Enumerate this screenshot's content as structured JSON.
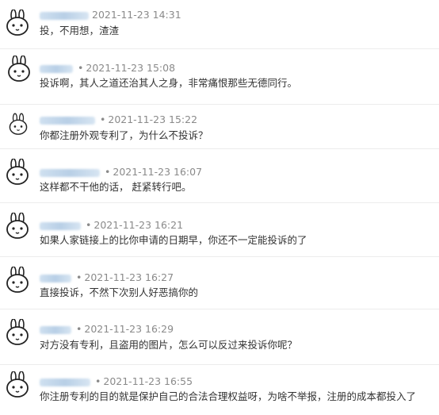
{
  "comments": [
    {
      "timestamp": "2021-11-23 14:31",
      "text": "投，不用想，渣渣"
    },
    {
      "timestamp": "2021-11-23 15:08",
      "text": "投诉啊，其人之道还治其人之身，非常痛恨那些无德同行。"
    },
    {
      "timestamp": "2021-11-23 15:22",
      "text": "你都注册外观专利了，为什么不投诉？"
    },
    {
      "timestamp": "2021-11-23 16:07",
      "text": "这样都不干他的话，  赶紧转行吧。"
    },
    {
      "timestamp": "2021-11-23 16:21",
      "text": "如果人家链接上的比你申请的日期早，你还不一定能投诉的了"
    },
    {
      "timestamp": "2021-11-23 16:27",
      "text": "直接投诉，不然下次别人好恶搞你的"
    },
    {
      "timestamp": "2021-11-23 16:29",
      "text": "对方没有专利，且盗用的图片，怎么可以反过来投诉你呢？"
    },
    {
      "timestamp": "2021-11-23 16:55",
      "text": "你注册专利的目的就是保护自己的合法合理权益呀，为啥不举报，注册的成本都投入了"
    }
  ],
  "separator": "•",
  "colors": {
    "username_blur": "#b8cfe6",
    "meta_text": "#8a8a8a",
    "comment_text": "#333333",
    "divider": "#ececec"
  }
}
